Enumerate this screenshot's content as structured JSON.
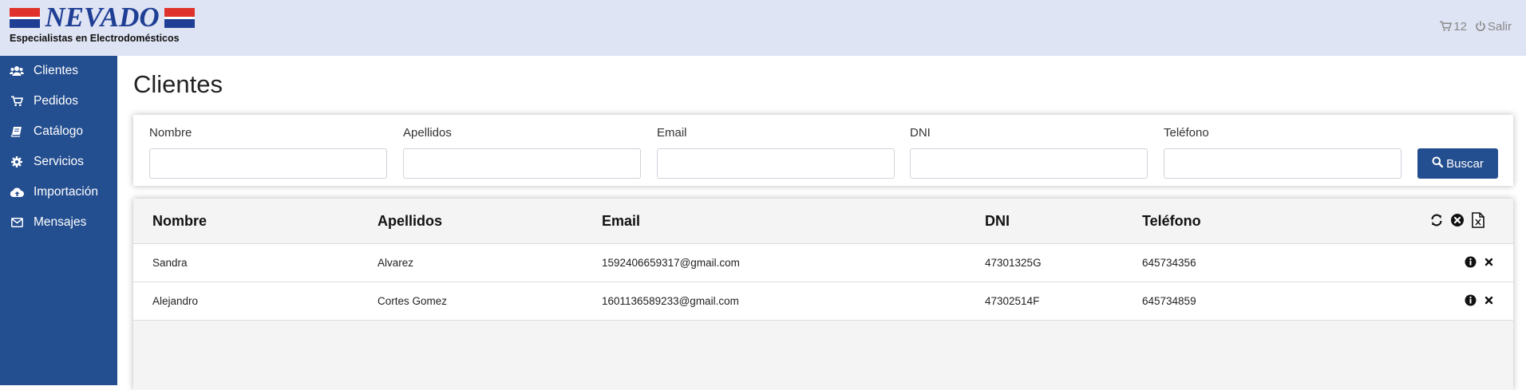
{
  "header": {
    "logo_name": "NEVADO",
    "logo_tagline": "Especialistas en Electrodomésticos",
    "cart_count": "12",
    "logout_label": "Salir"
  },
  "sidebar": {
    "items": [
      {
        "label": "Clientes",
        "icon": "users-icon"
      },
      {
        "label": "Pedidos",
        "icon": "cart-icon"
      },
      {
        "label": "Catálogo",
        "icon": "book-icon"
      },
      {
        "label": "Servicios",
        "icon": "gear-icon"
      },
      {
        "label": "Importación",
        "icon": "cloud-upload-icon"
      },
      {
        "label": "Mensajes",
        "icon": "envelope-icon"
      }
    ]
  },
  "main": {
    "title": "Clientes",
    "filters": [
      {
        "label": "Nombre",
        "value": "",
        "placeholder": ""
      },
      {
        "label": "Apellidos",
        "value": "",
        "placeholder": ""
      },
      {
        "label": "Email",
        "value": "",
        "placeholder": ""
      },
      {
        "label": "DNI",
        "value": "",
        "placeholder": ""
      },
      {
        "label": "Teléfono",
        "value": "",
        "placeholder": ""
      }
    ],
    "search_button": "Buscar",
    "table": {
      "columns": [
        "Nombre",
        "Apellidos",
        "Email",
        "DNI",
        "Teléfono"
      ],
      "toolbar_icons": [
        "refresh-icon",
        "clear-filter-icon",
        "export-excel-icon"
      ],
      "rows": [
        {
          "nombre": "Sandra",
          "apellidos": "Alvarez",
          "email": "1592406659317@gmail.com",
          "dni": "47301325G",
          "telefono": "645734356"
        },
        {
          "nombre": "Alejandro",
          "apellidos": "Cortes Gomez",
          "email": "1601136589233@gmail.com",
          "dni": "47302514F",
          "telefono": "645734859"
        }
      ]
    }
  },
  "colors": {
    "header_bg": "#dfe4f4",
    "sidebar_bg": "#234e8f",
    "brand_blue": "#1f3f95",
    "brand_red": "#e0322d"
  }
}
